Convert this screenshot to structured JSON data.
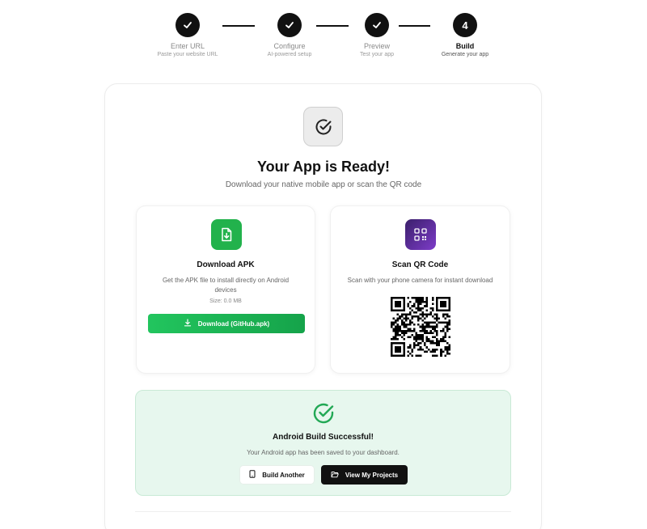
{
  "stepper": {
    "steps": [
      {
        "title": "Enter URL",
        "sub": "Paste your website URL",
        "state": "done"
      },
      {
        "title": "Configure",
        "sub": "AI-powered setup",
        "state": "done"
      },
      {
        "title": "Preview",
        "sub": "Test your app",
        "state": "done"
      },
      {
        "title": "Build",
        "sub": "Generate your app",
        "state": "active",
        "number": "4"
      }
    ]
  },
  "hero": {
    "title": "Your App is Ready!",
    "subtitle": "Download your native mobile app or scan the QR code",
    "icon": "check-circle-icon"
  },
  "apk": {
    "title": "Download APK",
    "description": "Get the APK file to install directly on Android devices",
    "size": "Size: 0.0 MB",
    "button_label": "Download (GitHub.apk)",
    "icon": "file-download-icon",
    "accent": "#22b24c"
  },
  "qr": {
    "title": "Scan QR Code",
    "description": "Scan with your phone camera for instant download",
    "icon": "qr-code-icon",
    "accent": "#6b2fb3"
  },
  "success": {
    "title": "Android Build Successful!",
    "subtitle": "Your Android app has been saved to your dashboard.",
    "build_another_label": "Build Another",
    "view_projects_label": "View My Projects",
    "accent": "#22a855"
  }
}
